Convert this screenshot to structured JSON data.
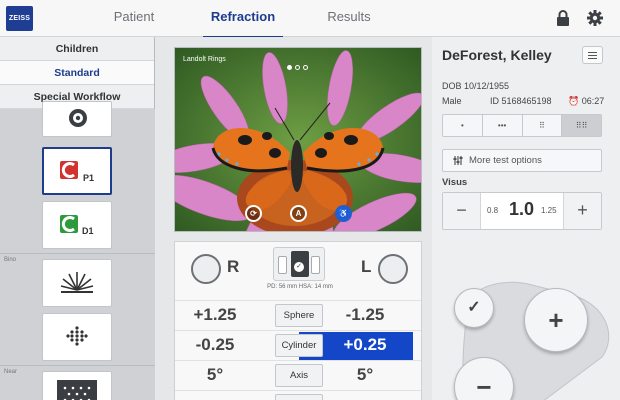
{
  "brand": {
    "logo_text": "ZEISS"
  },
  "nav": {
    "tabs": [
      {
        "label": "Patient"
      },
      {
        "label": "Refraction"
      },
      {
        "label": "Results"
      }
    ],
    "active": "Refraction"
  },
  "sidebar": {
    "modes": [
      {
        "label": "Children"
      },
      {
        "label": "Standard"
      },
      {
        "label": "Special Workflow"
      }
    ],
    "active_mode": "Standard",
    "sections": {
      "bino": "Bino",
      "near": "Near"
    },
    "tiles": [
      {
        "icon": "target-icon"
      },
      {
        "icon": "red-green-icon",
        "label": "P1",
        "selected": true
      },
      {
        "icon": "green-test-icon",
        "label": "D1"
      },
      {
        "icon": "fan-chart-icon"
      },
      {
        "icon": "dot-pattern-icon"
      },
      {
        "icon": "grid-pattern-icon"
      }
    ]
  },
  "image": {
    "label": "Landolt Rings",
    "page_indicator": {
      "pages": 3,
      "active": 1
    },
    "controls": [
      {
        "icon": "rotate-icon"
      },
      {
        "icon": "a-icon",
        "text": "A"
      },
      {
        "icon": "accessibility-icon"
      }
    ]
  },
  "refraction": {
    "left_eye_label": "R",
    "right_eye_label": "L",
    "pd_text": "PD: 56 mm   HSA: 14 mm",
    "rows": [
      {
        "param": "Sphere",
        "r_value": "+1.25",
        "l_value": "-1.25",
        "highlight": false
      },
      {
        "param": "Cylinder",
        "r_value": "-0.25",
        "l_value": "+0.25",
        "highlight": true
      },
      {
        "param": "Axis",
        "r_value": "5°",
        "l_value": "5°",
        "highlight": false
      }
    ],
    "highlight_color": "#1446c8"
  },
  "patient": {
    "name": "DeForest, Kelley",
    "dob": "DOB 10/12/1955",
    "sex": "Male",
    "id": "ID 5168465198",
    "time": "06:27"
  },
  "view_modes": [
    "•",
    "•••",
    "⠿",
    "⠿⠿"
  ],
  "more_tests_label": "More test options",
  "visus": {
    "label": "Visus",
    "prev": "0.8",
    "current": "1.0",
    "next": "1.25",
    "minus": "−",
    "plus": "+"
  },
  "joystick": {
    "confirm": "✓",
    "plus": "+",
    "minus": "−"
  },
  "colors": {
    "accent": "#1d3c8e",
    "highlight": "#1446c8",
    "logo_bg": "#1f3d93"
  }
}
